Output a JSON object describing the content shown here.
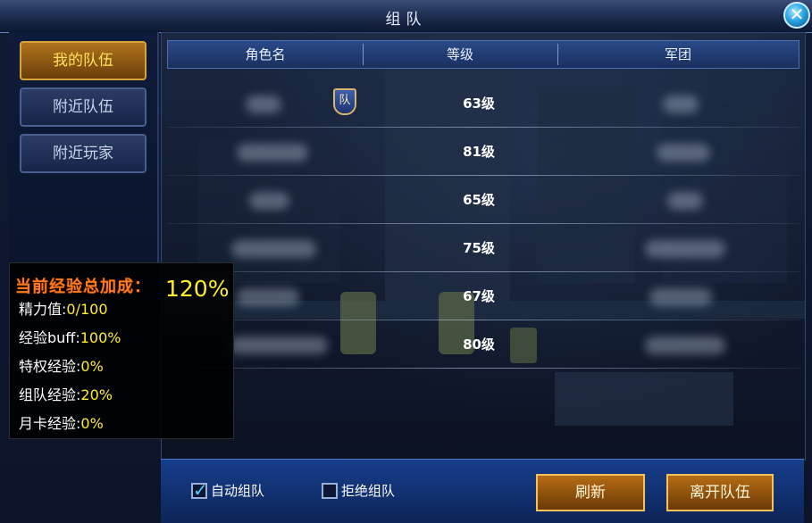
{
  "window": {
    "title": "组队"
  },
  "sidebar": {
    "tabs": [
      {
        "label": "我的队伍",
        "active": true
      },
      {
        "label": "附近队伍",
        "active": false
      },
      {
        "label": "附近玩家",
        "active": false
      }
    ]
  },
  "table": {
    "headers": [
      "角色名",
      "等级",
      "军团"
    ],
    "rows": [
      {
        "level": "63级",
        "leader_badge": "队"
      },
      {
        "level": "81级"
      },
      {
        "level": "65级"
      },
      {
        "level": "75级"
      },
      {
        "level": "67级"
      },
      {
        "level": "80级"
      }
    ]
  },
  "exp_panel": {
    "title": "当前经验总加成：",
    "total": "120%",
    "lines": [
      {
        "label": "精力值:",
        "value": "0/100"
      },
      {
        "label": "经验buff:",
        "value": "100%"
      },
      {
        "label": "特权经验:",
        "value": "0%"
      },
      {
        "label": "组队经验:",
        "value": "20%"
      },
      {
        "label": "月卡经验:",
        "value": "0%"
      }
    ]
  },
  "footer": {
    "auto_team_label": "自动组队",
    "auto_team_checked": true,
    "refuse_team_label": "拒绝组队",
    "refuse_team_checked": false,
    "refresh_label": "刷新",
    "leave_label": "离开队伍"
  },
  "colors": {
    "gold_accent": "#ffee2a",
    "orange_title": "#ff7a1a",
    "blue_header": "#2a4a88"
  }
}
